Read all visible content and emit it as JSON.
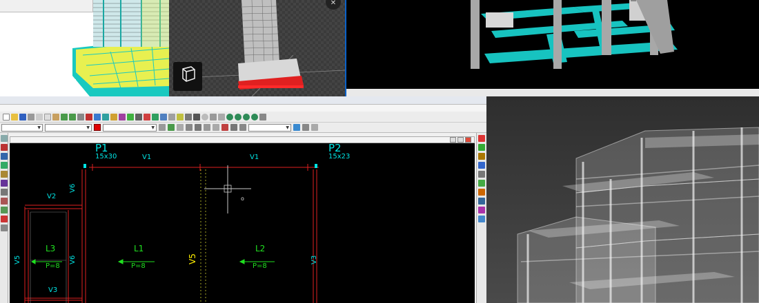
{
  "building_window": {
    "mini_bar_left": "",
    "mini_bar_right": ""
  },
  "viewer": {
    "close_icon": "✕",
    "cube_label": ""
  },
  "frame_window": {
    "tag": "",
    "taskbar_left": "",
    "taskbar_middle": "",
    "taskbar_right": ""
  },
  "cad": {
    "title": "",
    "menu": [
      "",
      "",
      "",
      "",
      "",
      "",
      "",
      "",
      ""
    ],
    "combos": {
      "layer": "",
      "type": "",
      "line": "",
      "mode": ""
    },
    "subwindow_title": "",
    "drawing": {
      "pillars": [
        {
          "name": "P1",
          "size": "15x30"
        },
        {
          "name": "P2",
          "size": "15x23"
        }
      ],
      "beams": [
        "V1",
        "V1",
        "V2",
        "V3",
        "V3",
        "V5",
        "V6",
        "V6"
      ],
      "slabs": [
        {
          "name": "L3",
          "load": "P=8"
        },
        {
          "name": "L1",
          "load": "P=8"
        },
        {
          "name": "L2",
          "load": "P=8"
        }
      ],
      "marker": "V5",
      "cursor_label": "o"
    }
  },
  "colors": {
    "cad_cyan": "#00e5e5",
    "cad_red": "#e02020",
    "cad_green": "#20e020",
    "frame_teal": "#17c3c0",
    "building_yellow": "#e8f050"
  }
}
